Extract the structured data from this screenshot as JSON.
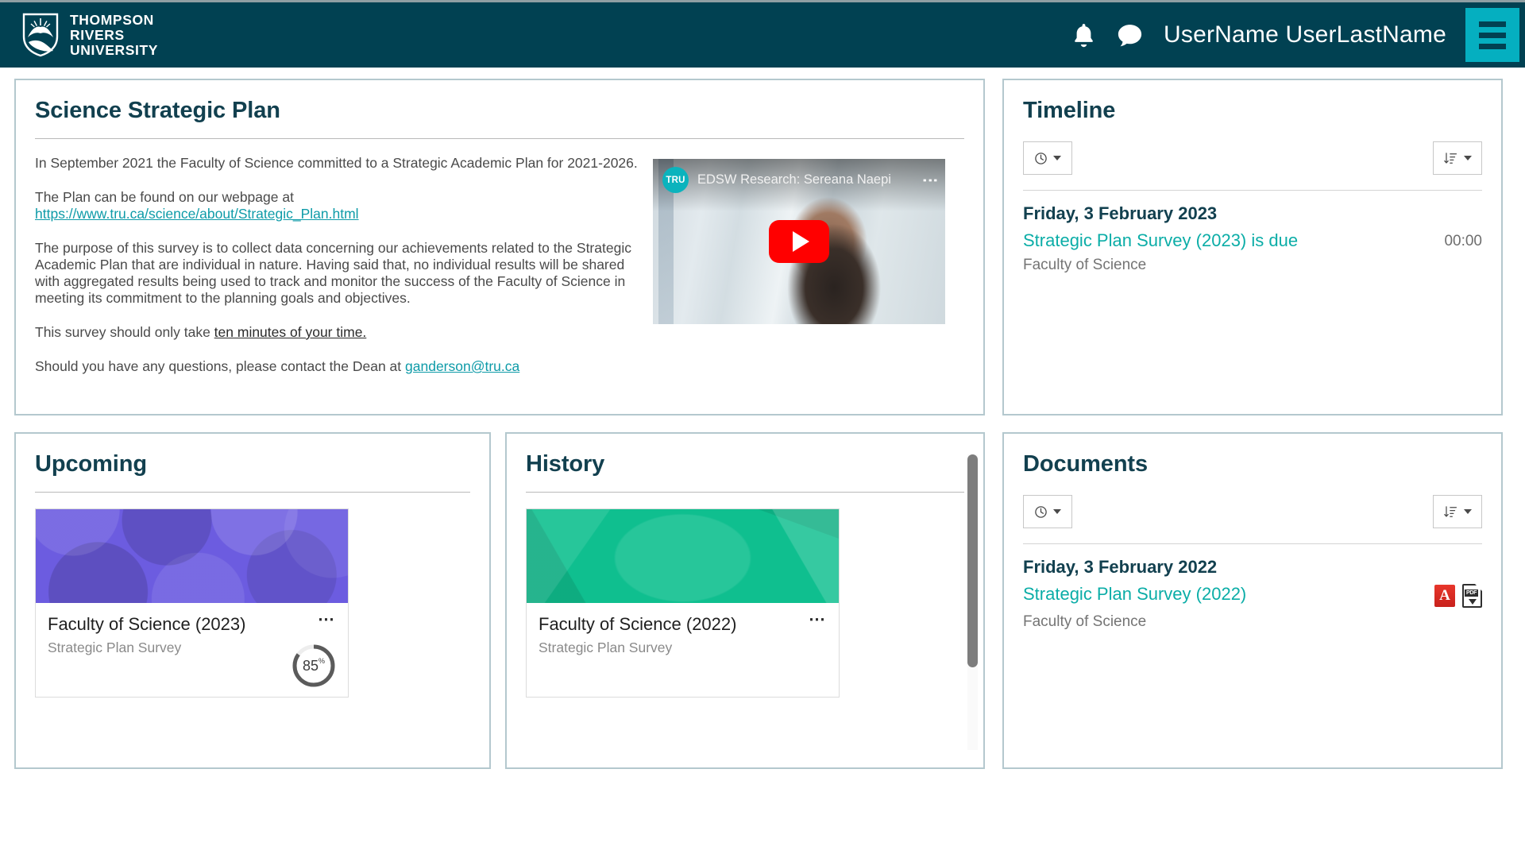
{
  "header": {
    "logo": {
      "line1": "THOMPSON",
      "line2": "RIVERS",
      "line3": "UNIVERSITY",
      "icon": "tru-shield-icon"
    },
    "notifications_icon": "bell-icon",
    "messages_icon": "chat-bubble-icon",
    "user_name": "UserName  UserLastName",
    "menu_icon": "hamburger-menu-icon",
    "bg_color": "#014152",
    "accent_color": "#05AFC0"
  },
  "strategic_plan": {
    "title": "Science Strategic Plan",
    "paragraph1": "In September 2021 the Faculty of Science committed to a Strategic Academic Plan for 2021-2026.",
    "paragraph2_prefix": "The Plan can be found on our webpage at",
    "plan_link": "https://www.tru.ca/science/about/Strategic_Plan.html",
    "paragraph3": "The purpose of this survey is to collect data concerning our achievements related to the Strategic Academic Plan that are individual in nature. Having said that, no individual results will be shared with aggregated results being used to track and monitor the success of the Faculty of Science in meeting its commitment to the planning goals and objectives.",
    "paragraph4_prefix": "This survey should only take ",
    "duration_link": "ten minutes of your time. ",
    "paragraph5_prefix": "Should you have any questions, please contact the Dean at ",
    "email_link": "ganderson@tru.ca",
    "video": {
      "channel_badge": "TRU",
      "title": "EDSW Research: Sereana Naepi",
      "menu_icon": "kebab-menu-icon",
      "play_icon": "youtube-play-icon"
    }
  },
  "upcoming": {
    "title": "Upcoming",
    "item": {
      "title": "Faculty of Science (2023)",
      "subtitle": "Strategic Plan Survey",
      "progress": "85",
      "progress_unit": "%",
      "menu_icon": "ellipsis-menu-icon",
      "banner_color": "#6C5CE0"
    }
  },
  "history": {
    "title": "History",
    "item": {
      "title": "Faculty of Science (2022)",
      "subtitle": "Strategic Plan Survey",
      "menu_icon": "ellipsis-menu-icon",
      "banner_color": "#0FBF8F"
    }
  },
  "timeline": {
    "title": "Timeline",
    "filter_icon": "clock-icon",
    "sort_icon": "sort-descending-icon",
    "entry": {
      "date": "Friday, 3 February 2023",
      "link": "Strategic Plan Survey (2023) is due",
      "time": "00:00",
      "org": "Faculty of Science"
    }
  },
  "documents": {
    "title": "Documents",
    "filter_icon": "clock-icon",
    "sort_icon": "sort-descending-icon",
    "entry": {
      "date": "Friday, 3 February 2022",
      "link": "Strategic Plan Survey (2022)",
      "org": "Faculty of Science",
      "pdf_icon": "adobe-pdf-icon",
      "download_icon": "pdf-download-icon"
    }
  }
}
